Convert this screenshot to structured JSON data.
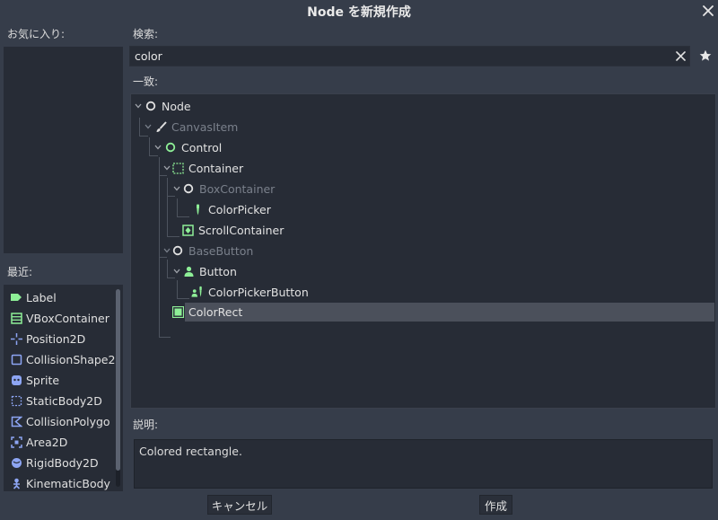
{
  "window": {
    "title": "Node を新規作成"
  },
  "favorites": {
    "label": "お気に入り:"
  },
  "recent": {
    "label": "最近:",
    "items": [
      {
        "label": "Label",
        "icon": "label-icon"
      },
      {
        "label": "VBoxContainer",
        "icon": "vbox-container-icon"
      },
      {
        "label": "Position2D",
        "icon": "position2d-icon"
      },
      {
        "label": "CollisionShape2",
        "icon": "collision-shape-icon"
      },
      {
        "label": "Sprite",
        "icon": "sprite-icon"
      },
      {
        "label": "StaticBody2D",
        "icon": "static-body-icon"
      },
      {
        "label": "CollisionPolygo",
        "icon": "collision-polygon-icon"
      },
      {
        "label": "Area2D",
        "icon": "area2d-icon"
      },
      {
        "label": "RigidBody2D",
        "icon": "rigid-body-icon"
      },
      {
        "label": "KinematicBody",
        "icon": "kinematic-body-icon"
      }
    ]
  },
  "search": {
    "label": "検索:",
    "value": "color"
  },
  "matches": {
    "label": "一致:",
    "items": [
      {
        "label": "Node",
        "icon": "node-icon",
        "dim": false
      },
      {
        "label": "CanvasItem",
        "icon": "canvas-item-icon",
        "dim": true
      },
      {
        "label": "Control",
        "icon": "control-icon",
        "dim": false
      },
      {
        "label": "Container",
        "icon": "container-icon",
        "dim": false
      },
      {
        "label": "BoxContainer",
        "icon": "box-container-icon",
        "dim": true
      },
      {
        "label": "ColorPicker",
        "icon": "color-picker-icon",
        "dim": false
      },
      {
        "label": "ScrollContainer",
        "icon": "scroll-container-icon",
        "dim": false
      },
      {
        "label": "BaseButton",
        "icon": "base-button-icon",
        "dim": true
      },
      {
        "label": "Button",
        "icon": "button-icon",
        "dim": false
      },
      {
        "label": "ColorPickerButton",
        "icon": "color-picker-button-icon",
        "dim": false
      },
      {
        "label": "ColorRect",
        "icon": "color-rect-icon",
        "dim": false,
        "selected": true
      }
    ]
  },
  "description": {
    "label": "説明:",
    "text": "Colored rectangle."
  },
  "buttons": {
    "cancel": "キャンセル",
    "create": "作成"
  },
  "colors": {
    "background": "#363d4a",
    "panel": "#272c36",
    "accent_green": "#8eef97",
    "selected": "#4b505b"
  }
}
